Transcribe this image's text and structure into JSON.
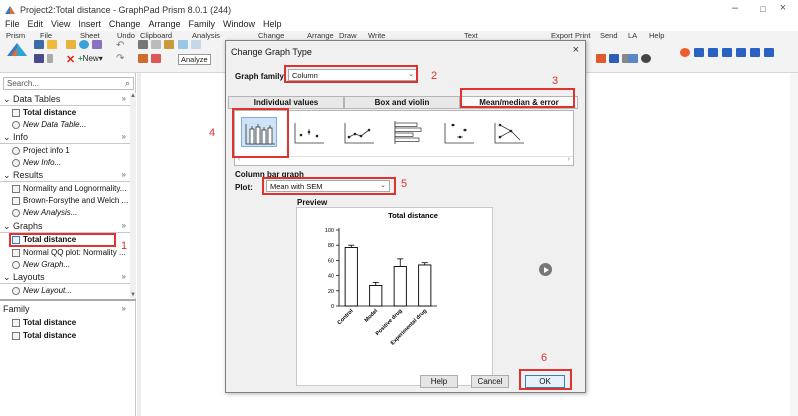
{
  "window": {
    "title": "Project2:Total distance - GraphPad Prism 8.0.1 (244)",
    "controls": {
      "minimize": "–",
      "maximize": "□",
      "close": "×"
    }
  },
  "menu": [
    "File",
    "Edit",
    "View",
    "Insert",
    "Change",
    "Arrange",
    "Family",
    "Window",
    "Help"
  ],
  "ribbon_groups": [
    "Prism",
    "File",
    "Sheet",
    "Undo",
    "Clipboard",
    "Analysis",
    "Change",
    "Arrange",
    "Draw",
    "Write",
    "Text",
    "Export",
    "Print",
    "Send",
    "LA",
    "Help"
  ],
  "ribbon_extra": {
    "analyze_label": "Analyze",
    "new_label": "New"
  },
  "sidebar": {
    "search_placeholder": "Search...",
    "sections": {
      "data_tables": {
        "label": "Data Tables",
        "items": [
          "Total distance",
          "New Data Table..."
        ]
      },
      "info": {
        "label": "Info",
        "items": [
          "Project info 1",
          "New Info..."
        ]
      },
      "results": {
        "label": "Results",
        "items": [
          "Normality and Lognormality...",
          "Brown-Forsythe and Welch ...",
          "New Analysis..."
        ]
      },
      "graphs": {
        "label": "Graphs",
        "items": [
          "Total distance",
          "Normal QQ plot: Normality ...",
          "New Graph..."
        ]
      },
      "layouts": {
        "label": "Layouts",
        "items": [
          "New Layout..."
        ]
      }
    },
    "family": {
      "label": "Family",
      "items": [
        "Total distance",
        "Total distance"
      ]
    }
  },
  "dialog": {
    "title": "Change Graph Type",
    "close": "×",
    "graph_family_label": "Graph family:",
    "graph_family_value": "Column",
    "tabs": [
      "Individual values",
      "Box and violin",
      "Mean/median & error"
    ],
    "section_label": "Column bar graph",
    "plot_label": "Plot:",
    "plot_value": "Mean with SEM",
    "preview_label": "Preview",
    "buttons": {
      "help": "Help",
      "cancel": "Cancel",
      "ok": "OK"
    }
  },
  "annotations": [
    "1",
    "2",
    "3",
    "4",
    "5",
    "6"
  ],
  "colors": {
    "annotation_red": "#e0332f",
    "selected_bg": "#cfe3f6",
    "selected_border": "#7eaedb"
  },
  "chart_data": {
    "type": "bar",
    "title": "Total distance",
    "categories": [
      "Control",
      "Model",
      "Positive drug",
      "Experimental drug"
    ],
    "values": [
      77,
      27,
      52,
      54
    ],
    "errors": [
      3,
      4,
      10,
      3
    ],
    "ylim": [
      0,
      100
    ],
    "yticks": [
      0,
      20,
      40,
      60,
      80,
      100
    ],
    "xlabel": "",
    "ylabel": ""
  }
}
